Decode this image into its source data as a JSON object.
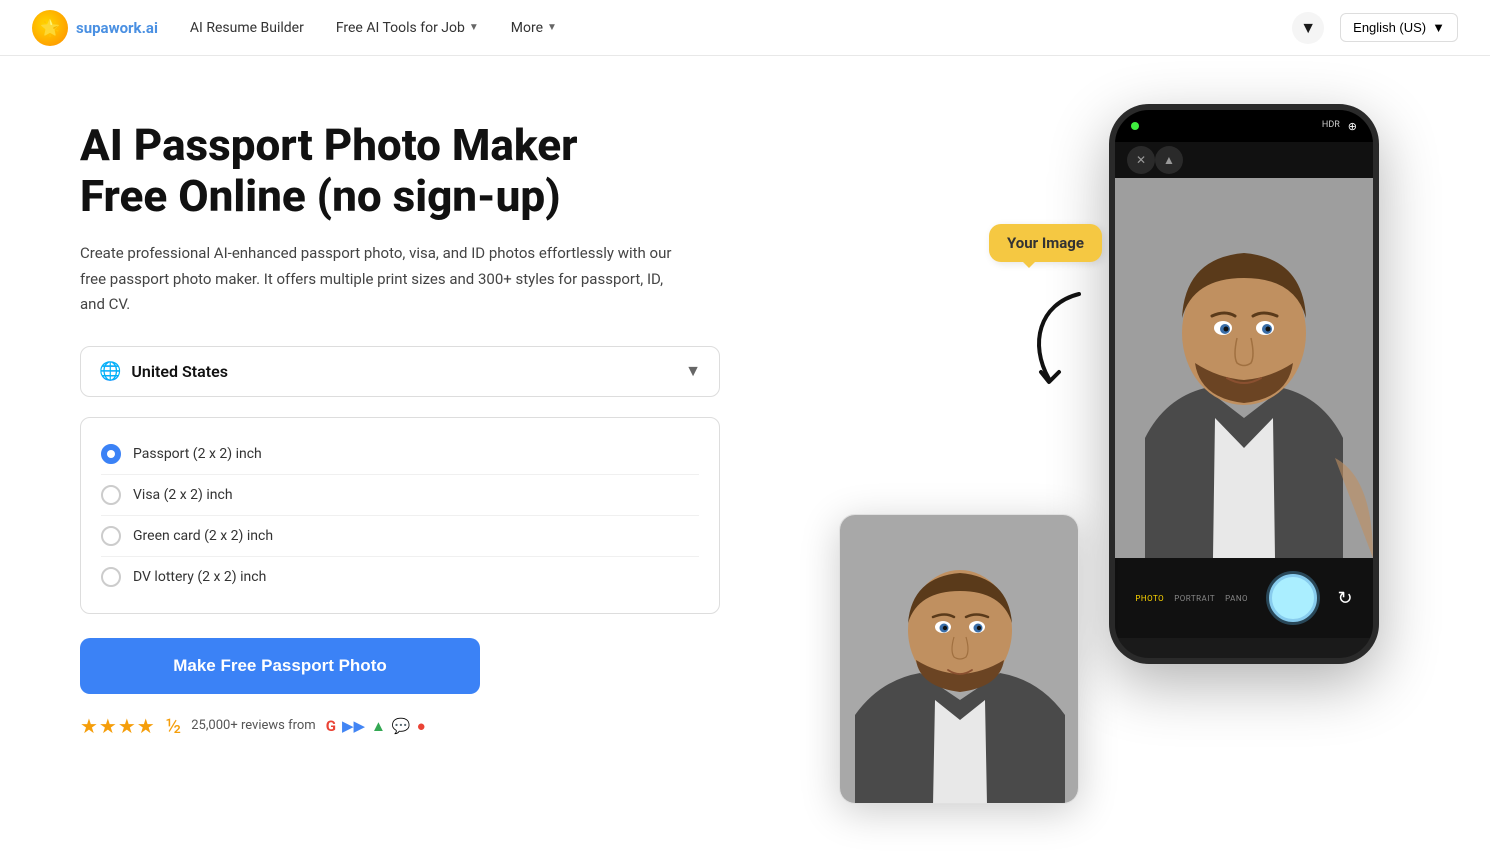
{
  "nav": {
    "logo_text": "supawork",
    "logo_suffix": ".ai",
    "links": [
      {
        "id": "ai-resume",
        "label": "AI Resume Builder"
      },
      {
        "id": "free-ai-tools",
        "label": "Free AI Tools for Job",
        "hasDropdown": true
      },
      {
        "id": "more",
        "label": "More",
        "hasDropdown": true
      }
    ],
    "language": "English (US)"
  },
  "hero": {
    "title": "AI Passport Photo Maker Free Online (no sign-up)",
    "description": "Create professional AI-enhanced passport photo, visa, and ID photos effortlessly with our free passport photo maker. It offers multiple print sizes and 300+ styles for passport, ID, and CV.",
    "country_selector": {
      "label": "United States",
      "icon": "🌐"
    },
    "options": [
      {
        "id": "passport",
        "label": "Passport (2 x 2) inch",
        "selected": true
      },
      {
        "id": "visa",
        "label": "Visa (2 x 2) inch",
        "selected": false
      },
      {
        "id": "green-card",
        "label": "Green card (2 x 2) inch",
        "selected": false
      },
      {
        "id": "dv-lottery",
        "label": "DV lottery (2 x 2) inch",
        "selected": false
      }
    ],
    "cta_label": "Make Free Passport Photo",
    "reviews": {
      "stars": "★★★★½",
      "text": "25,000+ reviews from",
      "rating": 4.5
    },
    "speech_bubble": "Your Image"
  },
  "phone": {
    "status_dot_color": "#3eed3e",
    "controls": [
      "✕",
      "▲",
      "HDR",
      "⊕"
    ],
    "modes": [
      "PHOTO",
      "PORTRAIT",
      "PANO"
    ],
    "active_mode": "PHOTO"
  }
}
